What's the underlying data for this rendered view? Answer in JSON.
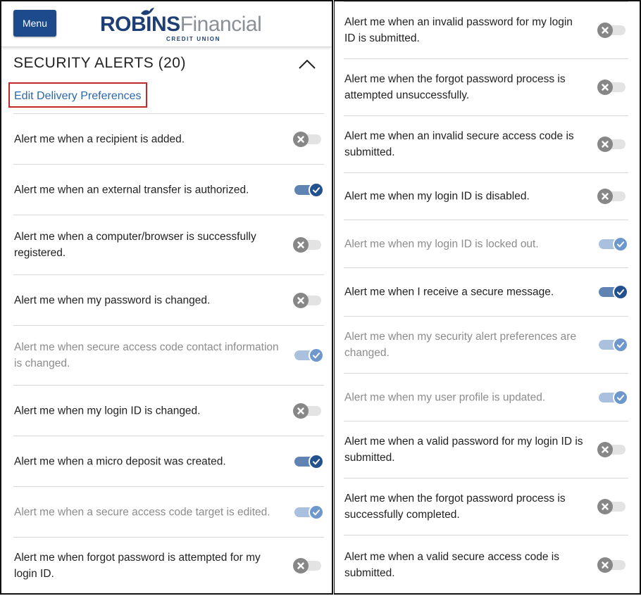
{
  "header": {
    "menu_label": "Menu",
    "logo_name_bold": "ROBINS",
    "logo_name_light": "Financial",
    "logo_sub": "CREDIT UNION"
  },
  "section": {
    "title": "SECURITY ALERTS (20)",
    "edit_link": "Edit Delivery Preferences"
  },
  "left_alerts": [
    {
      "label": "Alert me when a recipient is added.",
      "enabled": false,
      "dimmed": false
    },
    {
      "label": "Alert me when an external transfer is authorized.",
      "enabled": true,
      "dimmed": false
    },
    {
      "label": "Alert me when a computer/browser is successfully registered.",
      "enabled": false,
      "dimmed": false
    },
    {
      "label": "Alert me when my password is changed.",
      "enabled": false,
      "dimmed": false
    },
    {
      "label": "Alert me when secure access code contact information is changed.",
      "enabled": true,
      "dimmed": true
    },
    {
      "label": "Alert me when my login ID is changed.",
      "enabled": false,
      "dimmed": false
    },
    {
      "label": "Alert me when a micro deposit was created.",
      "enabled": true,
      "dimmed": false
    },
    {
      "label": "Alert me when a secure access code target is edited.",
      "enabled": true,
      "dimmed": true
    },
    {
      "label": "Alert me when forgot password is attempted for my login ID.",
      "enabled": false,
      "dimmed": false
    }
  ],
  "right_alerts": [
    {
      "label": "Alert me when an invalid password for my login ID is submitted.",
      "enabled": false,
      "dimmed": false
    },
    {
      "label": "Alert me when the forgot password process is attempted unsuccessfully.",
      "enabled": false,
      "dimmed": false
    },
    {
      "label": "Alert me when an invalid secure access code is submitted.",
      "enabled": false,
      "dimmed": false
    },
    {
      "label": "Alert me when my login ID is disabled.",
      "enabled": false,
      "dimmed": false
    },
    {
      "label": "Alert me when my login ID is locked out.",
      "enabled": true,
      "dimmed": true
    },
    {
      "label": "Alert me when I receive a secure message.",
      "enabled": true,
      "dimmed": false
    },
    {
      "label": "Alert me when my security alert preferences are changed.",
      "enabled": true,
      "dimmed": true
    },
    {
      "label": "Alert me when my user profile is updated.",
      "enabled": true,
      "dimmed": true
    },
    {
      "label": "Alert me when a valid password for my login ID is submitted.",
      "enabled": false,
      "dimmed": false
    },
    {
      "label": "Alert me when the forgot password process is successfully completed.",
      "enabled": false,
      "dimmed": false
    },
    {
      "label": "Alert me when a valid secure access code is submitted.",
      "enabled": false,
      "dimmed": false
    }
  ],
  "icons": {
    "toggle_on": "check-icon",
    "toggle_off": "x-icon",
    "collapse": "chevron-up-icon"
  },
  "colors": {
    "brand": "#1e3f75",
    "link": "#2a67b1",
    "highlight": "#c0282d",
    "toggle_on": "#23518d",
    "toggle_off": "#878787"
  }
}
